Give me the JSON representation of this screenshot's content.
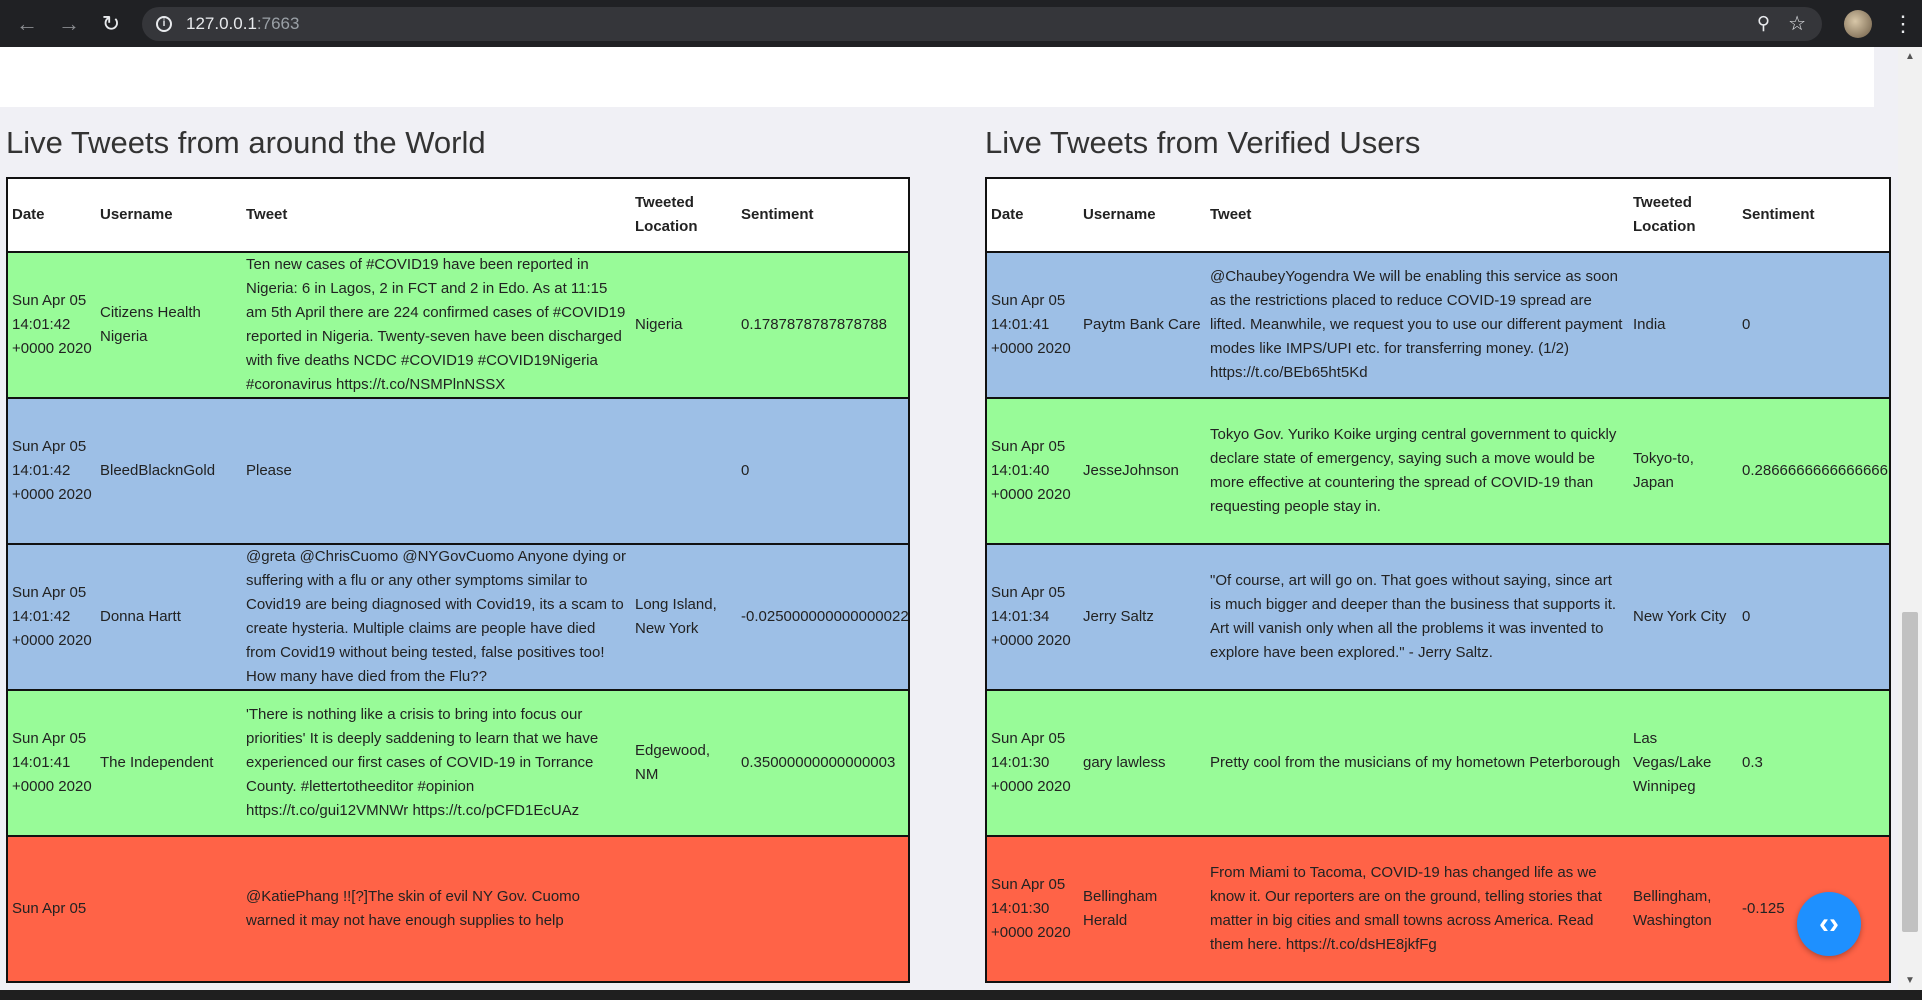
{
  "browser": {
    "url_host": "127.0.0.1",
    "url_port": ":7663"
  },
  "left": {
    "title": "Live Tweets from around the World",
    "headers": {
      "date": "Date",
      "username": "Username",
      "tweet": "Tweet",
      "location": "Tweeted Location",
      "sentiment": "Sentiment"
    },
    "rows": [
      {
        "color": "green",
        "date": "Sun Apr 05 14:01:42 +0000 2020",
        "username": "Citizens Health Nigeria",
        "tweet": "Ten new cases of #COVID19 have been reported in Nigeria: 6 in Lagos, 2 in FCT and 2 in Edo. As at 11:15 am 5th April there are 224 confirmed cases of #COVID19 reported in Nigeria. Twenty-seven have been discharged with five deaths NCDC #COVID19 #COVID19Nigeria #coronavirus https://t.co/NSMPlnNSSX",
        "location": "Nigeria",
        "sentiment": "0.1787878787878788"
      },
      {
        "color": "blue",
        "date": "Sun Apr 05 14:01:42 +0000 2020",
        "username": "BleedBlacknGold",
        "tweet": "Please",
        "location": "",
        "sentiment": "0"
      },
      {
        "color": "blue",
        "date": "Sun Apr 05 14:01:42 +0000 2020",
        "username": "Donna Hartt",
        "tweet": "@greta @ChrisCuomo @NYGovCuomo Anyone dying or suffering with a flu or any other symptoms similar to Covid19 are being diagnosed with Covid19, its a scam to create hysteria. Multiple claims are people have died from Covid19 without being tested, false positives too! How many have died from the Flu??",
        "location": "Long Island, New York",
        "sentiment": "-0.025000000000000022"
      },
      {
        "color": "green",
        "date": "Sun Apr 05 14:01:41 +0000 2020",
        "username": "The Independent",
        "tweet": "'There is nothing like a crisis to bring into focus our priorities' It is deeply saddening to learn that we have experienced our first cases of COVID-19 in Torrance County. #lettertotheeditor #opinion https://t.co/gui12VMNWr https://t.co/pCFD1EcUAz",
        "location": "Edgewood, NM",
        "sentiment": "0.35000000000000003"
      },
      {
        "color": "red",
        "date": "Sun Apr 05",
        "username": "",
        "tweet": "@KatiePhang !![?]The skin of evil NY Gov. Cuomo warned it may not have enough supplies to help",
        "location": "",
        "sentiment": ""
      }
    ]
  },
  "right": {
    "title": "Live Tweets from Verified Users",
    "headers": {
      "date": "Date",
      "username": "Username",
      "tweet": "Tweet",
      "location": "Tweeted Location",
      "sentiment": "Sentiment"
    },
    "rows": [
      {
        "color": "blue",
        "date": "Sun Apr 05 14:01:41 +0000 2020",
        "username": "Paytm Bank Care",
        "tweet": "@ChaubeyYogendra We will be enabling this service as soon as the restrictions placed to reduce COVID-19 spread are lifted. Meanwhile, we request you to use our different payment modes like IMPS/UPI etc. for transferring money. (1/2) https://t.co/BEb65ht5Kd",
        "location": "India",
        "sentiment": "0"
      },
      {
        "color": "green",
        "date": "Sun Apr 05 14:01:40 +0000 2020",
        "username": "JesseJohnson",
        "tweet": "Tokyo Gov. Yuriko Koike urging central government to quickly declare state of emergency, saying such a move would be more effective at countering the spread of COVID-19 than requesting people stay in.",
        "location": "Tokyo-to, Japan",
        "sentiment": "0.2866666666666666"
      },
      {
        "color": "blue",
        "date": "Sun Apr 05 14:01:34 +0000 2020",
        "username": "Jerry Saltz",
        "tweet": "\"Of course, art will go on. That goes without saying, since art is much bigger and deeper than the business that supports it. Art will vanish only when all the problems it was invented to explore have been explored.\" - Jerry Saltz.",
        "location": "New York City",
        "sentiment": "0"
      },
      {
        "color": "green",
        "date": "Sun Apr 05 14:01:30 +0000 2020",
        "username": "gary lawless",
        "tweet": "Pretty cool from the musicians of my hometown Peterborough",
        "location": "Las Vegas/Lake Winnipeg",
        "sentiment": "0.3"
      },
      {
        "color": "red",
        "date": "Sun Apr 05 14:01:30 +0000 2020",
        "username": "Bellingham Herald",
        "tweet": "From Miami to Tacoma, COVID-19 has changed life as we know it. Our reporters are on the ground, telling stories that matter in big cities and small towns across America. Read them here. https://t.co/dsHE8jkfFg",
        "location": "Bellingham, Washington",
        "sentiment": "-0.125"
      }
    ]
  },
  "icons": {
    "back": "back-arrow-icon",
    "forward": "forward-arrow-icon",
    "reload": "reload-icon",
    "info": "info-icon",
    "zoom": "zoom-icon",
    "star": "star-icon",
    "code": "code-icon"
  },
  "colors": {
    "green": "#98fb98",
    "blue": "#9dbfe6",
    "red": "#ff6347",
    "fab": "#1e90ff"
  }
}
